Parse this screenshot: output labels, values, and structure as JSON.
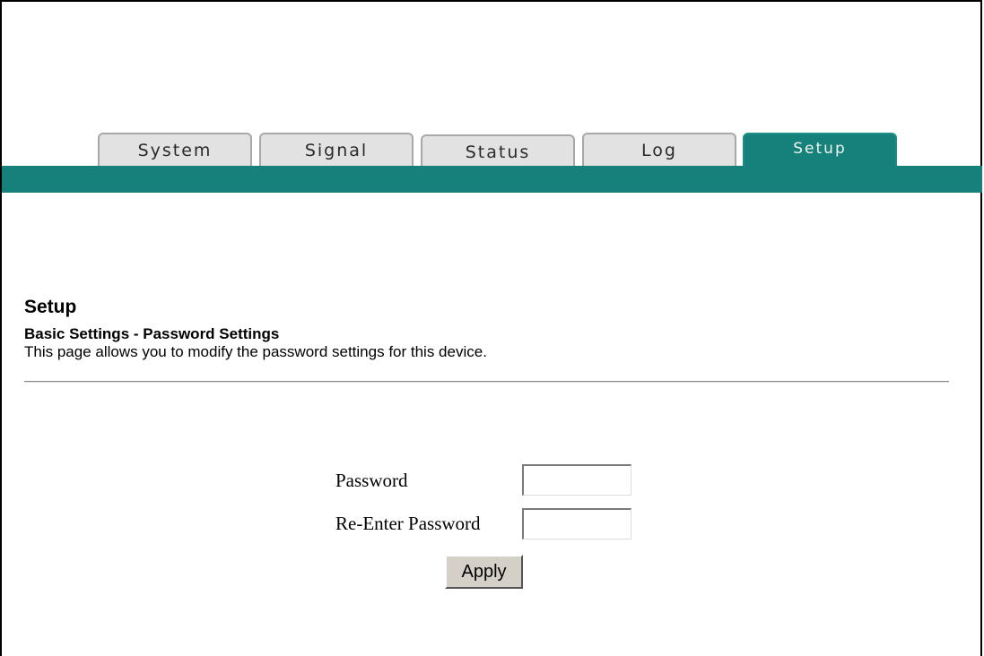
{
  "tabs": [
    {
      "label": "System",
      "active": false
    },
    {
      "label": "Signal",
      "active": false
    },
    {
      "label": "Status",
      "active": false
    },
    {
      "label": "Log",
      "active": false
    },
    {
      "label": "Setup",
      "active": true
    }
  ],
  "colors": {
    "accent": "#16807a",
    "tab_inactive": "#e2e2e2"
  },
  "page": {
    "heading": "Setup",
    "subheading": "Basic Settings - Password Settings",
    "description": "This page allows you to modify the password settings for this device."
  },
  "form": {
    "password_label": "Password",
    "password_value": "",
    "reenter_label": "Re-Enter Password",
    "reenter_value": "",
    "apply_label": "Apply"
  }
}
